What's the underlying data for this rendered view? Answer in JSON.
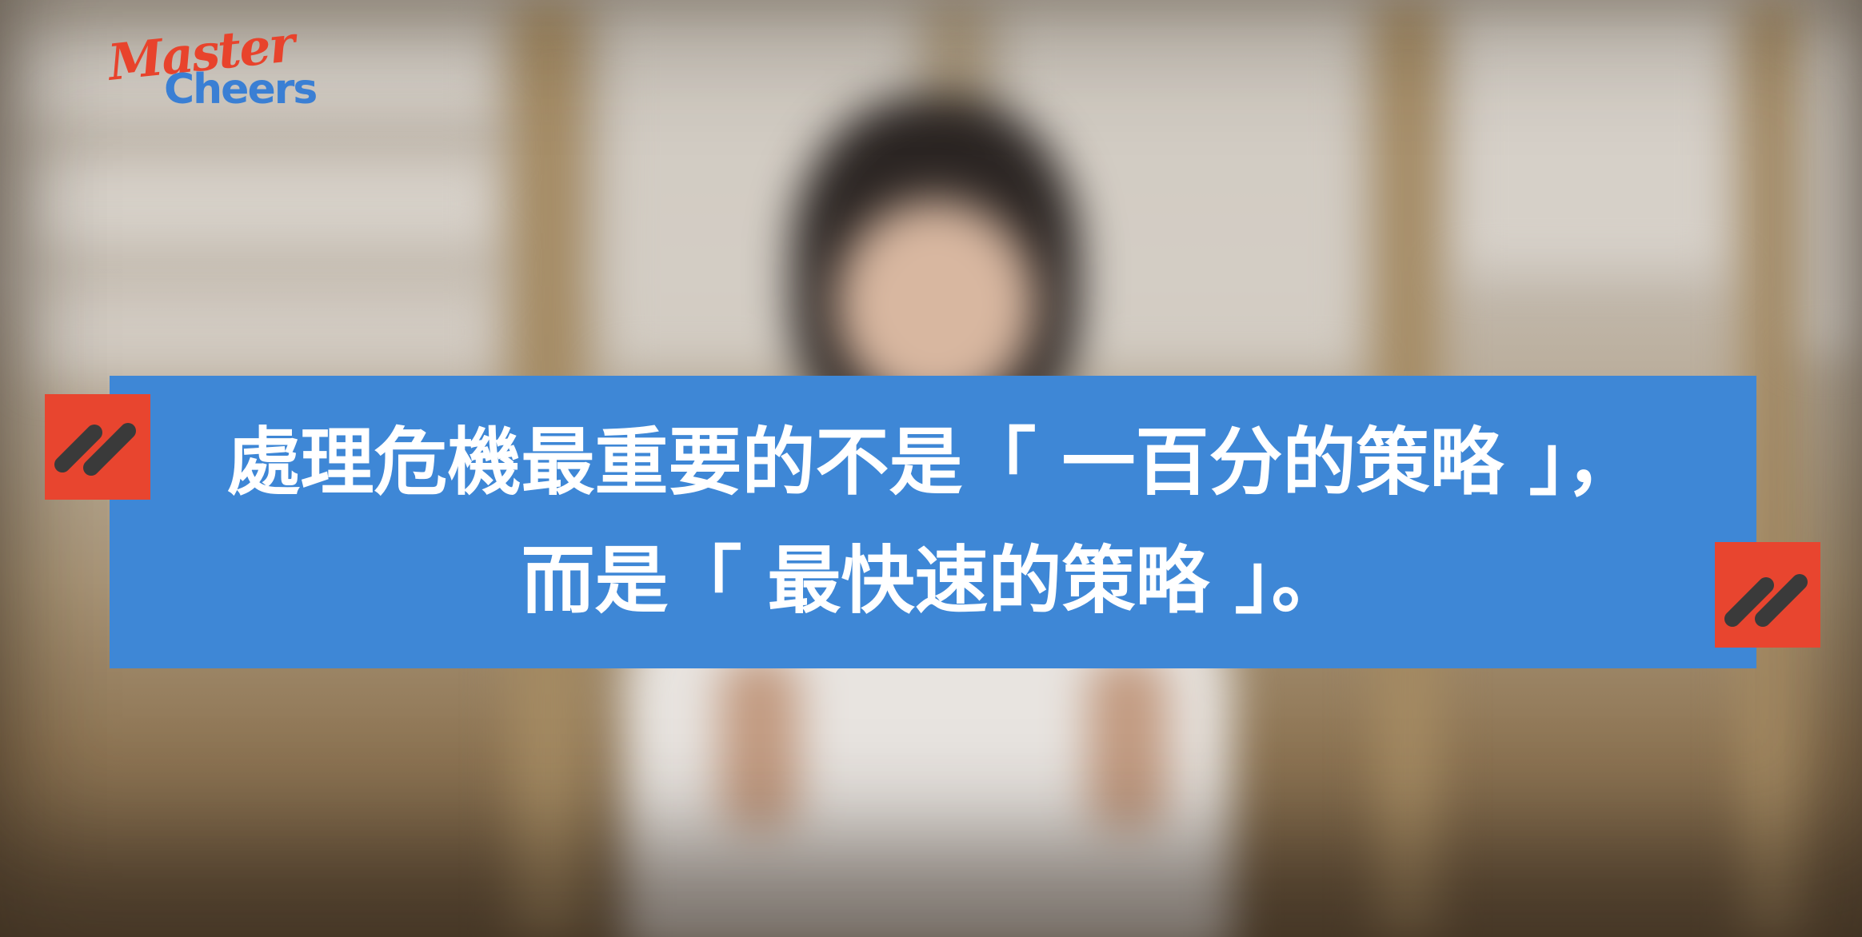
{
  "logo": {
    "line1": "Master",
    "line2": "Cheers"
  },
  "caption": {
    "line1": "處理危機最重要的不是「 一百分的策略 」，",
    "line2": "而是「 最快速的策略 」。"
  },
  "colors": {
    "banner": "#3e87d6",
    "tag": "#e8452f",
    "tag_mark": "#3a3a3a",
    "text": "#ffffff",
    "logo_red": "#e8432c",
    "logo_blue": "#3a7fd4"
  },
  "icons": {
    "tag_left": "double-slash-icon",
    "tag_right": "double-slash-icon"
  }
}
